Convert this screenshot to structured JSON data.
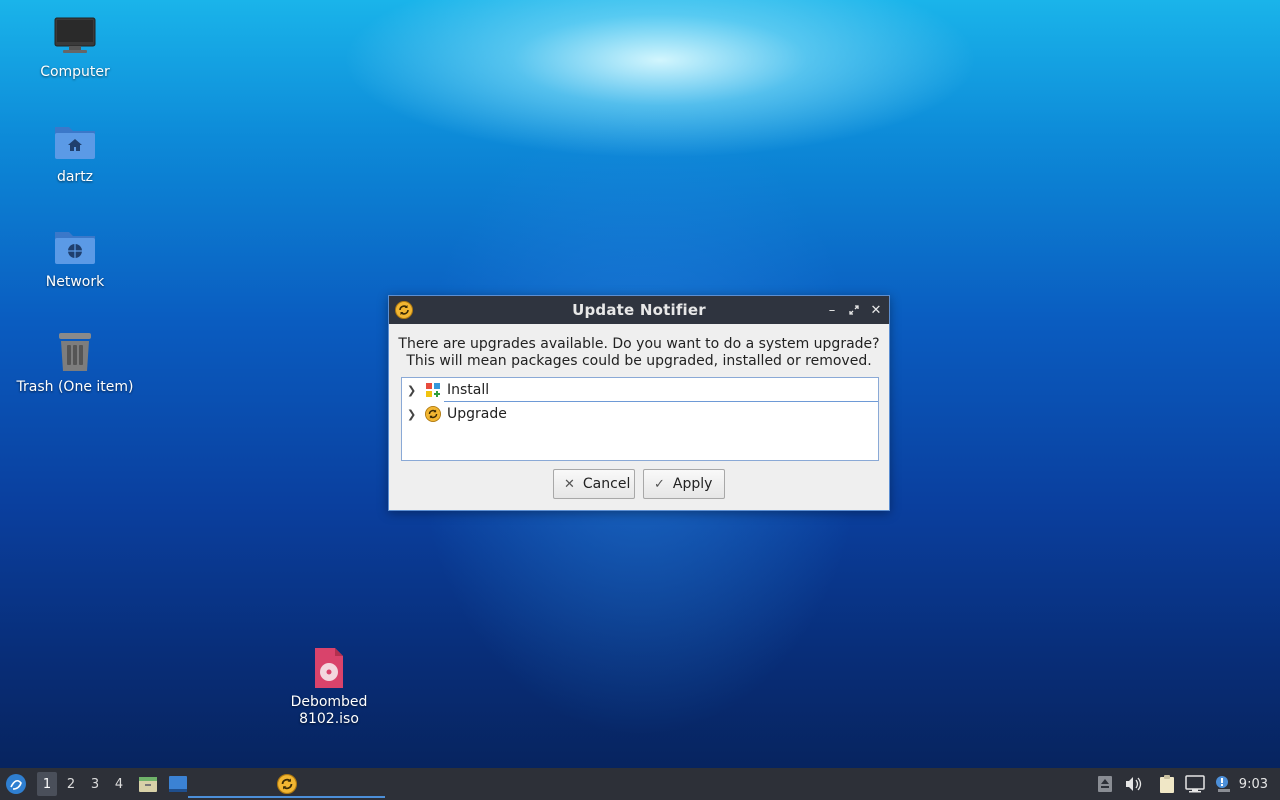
{
  "desktop": {
    "icons": [
      {
        "label": "Computer"
      },
      {
        "label": "dartz"
      },
      {
        "label": "Network"
      },
      {
        "label": "Trash (One item)"
      },
      {
        "label": "Debombed\n8102.iso"
      }
    ]
  },
  "dialog": {
    "title": "Update Notifier",
    "message_line1": "There are upgrades available. Do you want to do a system upgrade?",
    "message_line2": "This will mean packages could be upgraded, installed or removed.",
    "tree_items": [
      {
        "label": "Install",
        "icon": "package-install-icon"
      },
      {
        "label": "Upgrade",
        "icon": "update-icon"
      }
    ],
    "cancel_label": "Cancel",
    "apply_label": "Apply"
  },
  "taskbar": {
    "workspaces": [
      "1",
      "2",
      "3",
      "4"
    ],
    "active_workspace": "1",
    "clock": "9:03"
  },
  "colors": {
    "titlebar": "#2f343f",
    "taskbar": "#2d3038",
    "accent": "#4c8fd9"
  }
}
